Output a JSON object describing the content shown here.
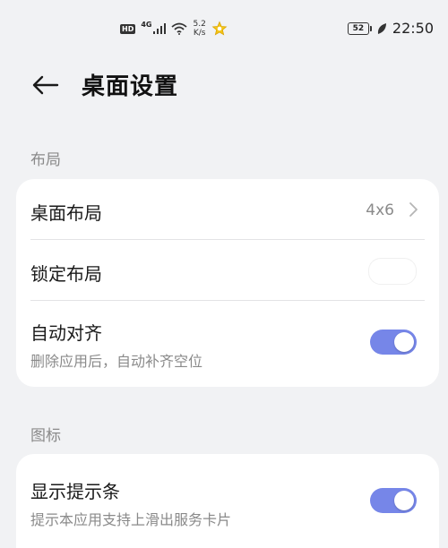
{
  "status_bar": {
    "hd": "HD",
    "network": "4G",
    "speed_value": "5.2",
    "speed_unit": "K/s",
    "battery": "52",
    "time": "22:50"
  },
  "header": {
    "title": "桌面设置"
  },
  "sections": {
    "layout": {
      "header": "布局",
      "rows": {
        "desktop_layout": {
          "title": "桌面布局",
          "value": "4x6"
        },
        "lock_layout": {
          "title": "锁定布局",
          "toggle": false
        },
        "auto_align": {
          "title": "自动对齐",
          "subtitle": "删除应用后，自动补齐空位",
          "toggle": true
        }
      }
    },
    "icons": {
      "header": "图标",
      "rows": {
        "show_hint_bar": {
          "title": "显示提示条",
          "subtitle": "提示本应用支持上滑出服务卡片",
          "toggle": true
        }
      }
    }
  },
  "colors": {
    "background": "#f1f2f4",
    "card": "#ffffff",
    "accent": "#7686e8",
    "secondary_text": "#8a8a8a"
  }
}
